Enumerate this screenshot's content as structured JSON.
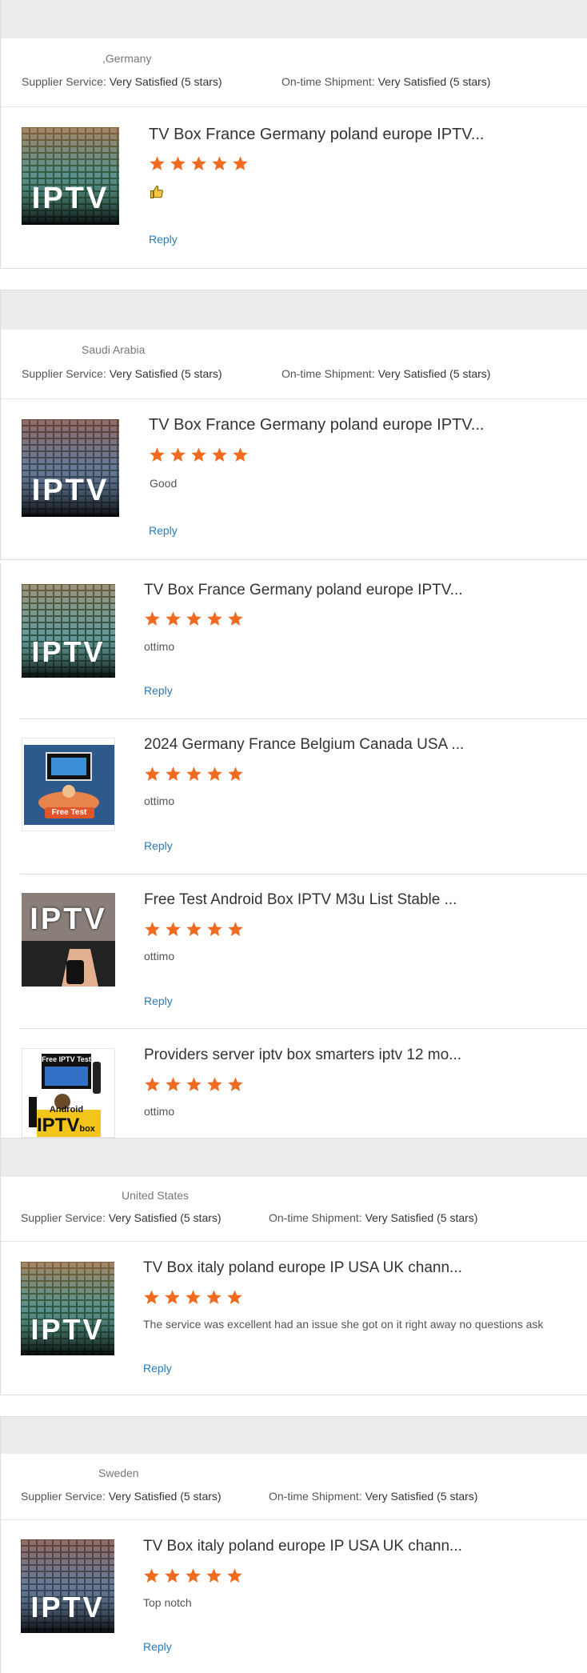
{
  "colors": {
    "star": "#f06a1f",
    "reply": "#2b7bb9",
    "header_band": "#ececec"
  },
  "reviews": [
    {
      "country": ",Germany",
      "supplier_label": "Supplier Service:",
      "supplier_value": "Very Satisfied",
      "supplier_stars": "(5 stars)",
      "shipment_label": "On-time Shipment:",
      "shipment_value": "Very Satisfied",
      "shipment_stars": "(5 stars)",
      "title": "TV Box France Germany poland europe IPTV...",
      "rating": 5,
      "comment_icon": "thumbs-up-icon",
      "reply": "Reply"
    },
    {
      "country": "Saudi Arabia",
      "supplier_label": "Supplier Service:",
      "supplier_value": "Very Satisfied",
      "supplier_stars": "(5 stars)",
      "shipment_label": "On-time Shipment:",
      "shipment_value": "Very Satisfied",
      "shipment_stars": "(5 stars)",
      "title": "TV Box France Germany poland europe IPTV...",
      "rating": 5,
      "comment": "Good",
      "reply": "Reply"
    }
  ],
  "multi": [
    {
      "title": "TV Box France Germany poland europe IPTV...",
      "rating": 5,
      "comment": "ottimo",
      "reply": "Reply",
      "thumb_text": "IPTV"
    },
    {
      "title": "2024 Germany France Belgium Canada USA ...",
      "rating": 5,
      "comment": "ottimo",
      "reply": "Reply",
      "thumb_text": "Free Test"
    },
    {
      "title": "Free Test Android Box IPTV M3u List Stable ...",
      "rating": 5,
      "comment": "ottimo",
      "reply": "Reply",
      "thumb_text": "IPTV"
    },
    {
      "title": "Providers server iptv box smarters iptv 12 mo...",
      "rating": 5,
      "comment": "ottimo",
      "thumb_text": "Free IPTV Test",
      "thumb_text2": "Android",
      "thumb_text3": "IPTV",
      "thumb_text4": "box"
    }
  ],
  "reviews2": [
    {
      "country": "United States",
      "supplier_label": "Supplier Service:",
      "supplier_value": "Very Satisfied",
      "supplier_stars": "(5 stars)",
      "shipment_label": "On-time Shipment:",
      "shipment_value": "Very Satisfied",
      "shipment_stars": "(5 stars)",
      "title": "TV Box italy poland europe IP USA UK chann...",
      "rating": 5,
      "comment": "The service was excellent had an issue she got on it right away no questions ask",
      "reply": "Reply"
    },
    {
      "country": "Sweden",
      "supplier_label": "Supplier Service:",
      "supplier_value": "Very Satisfied",
      "supplier_stars": "(5 stars)",
      "shipment_label": "On-time Shipment:",
      "shipment_value": "Very Satisfied",
      "shipment_stars": "(5 stars)",
      "title": "TV Box italy poland europe IP USA UK chann...",
      "rating": 5,
      "comment": "Top notch",
      "reply": "Reply"
    }
  ],
  "iptv_label": "IPTV"
}
